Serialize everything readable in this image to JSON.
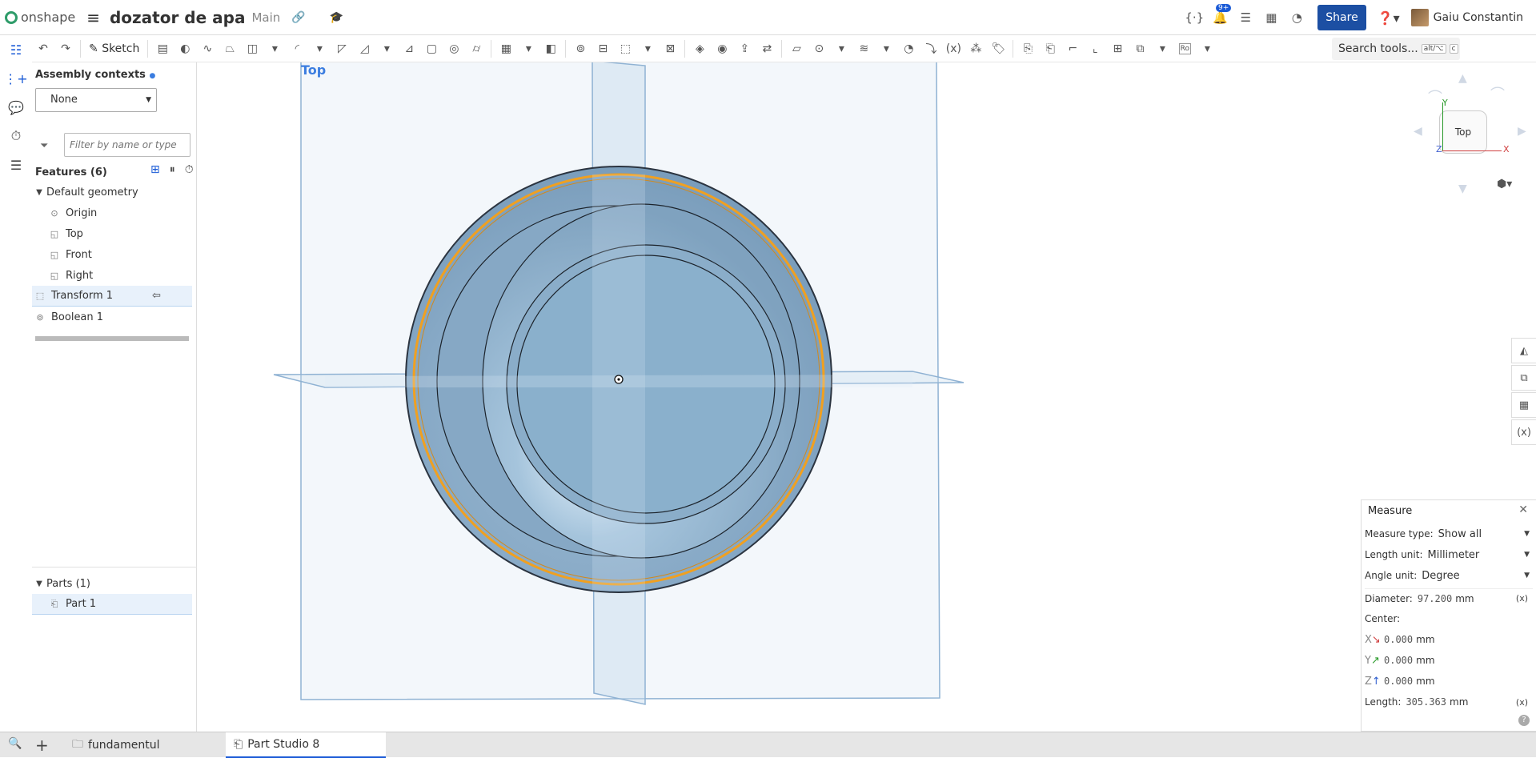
{
  "app": {
    "logo_text": "onshape",
    "doc_title": "dozator de apa",
    "branch": "Main",
    "notification_badge": "9+"
  },
  "topbar": {
    "share_label": "Share",
    "user_name": "Gaiu Constantin"
  },
  "toolbar": {
    "sketch_label": "Sketch",
    "search_label": "Search tools...",
    "search_kbd1": "alt/⌥",
    "search_kbd2": "c",
    "ro_label": "Ro"
  },
  "panel": {
    "contexts_title": "Assembly contexts",
    "contexts_value": "None",
    "filter_placeholder": "Filter by name or type",
    "features_title": "Features (6)",
    "default_geometry": "Default geometry",
    "items": [
      "Origin",
      "Top",
      "Front",
      "Right"
    ],
    "features": [
      "Transform 1",
      "Boolean 1"
    ],
    "parts_title": "Parts (1)",
    "parts": [
      "Part 1"
    ]
  },
  "viewport": {
    "view_label": "Top",
    "cube_label": "Top",
    "axis_x": "X",
    "axis_y": "Y",
    "axis_z": "Z"
  },
  "measure": {
    "title": "Measure",
    "type_label": "Measure type:",
    "type_value": "Show all",
    "length_label": "Length unit:",
    "length_value": "Millimeter",
    "angle_label": "Angle unit:",
    "angle_value": "Degree",
    "diameter_label": "Diameter:",
    "diameter_value": "97.200",
    "diameter_unit": "mm",
    "center_label": "Center:",
    "x_label": "X",
    "x_value": "0.000",
    "y_label": "Y",
    "y_value": "0.000",
    "z_label": "Z",
    "z_value": "0.000",
    "unit": "mm",
    "length_meas_label": "Length:",
    "length_meas_value": "305.363",
    "fx": "(x)"
  },
  "tabs": [
    {
      "label": "fundamentul"
    },
    {
      "label": "Part Studio 8"
    }
  ],
  "colors": {
    "accent": "#1a5ad6",
    "part_fill": "#8fb3cf",
    "highlight": "#f0a020"
  }
}
